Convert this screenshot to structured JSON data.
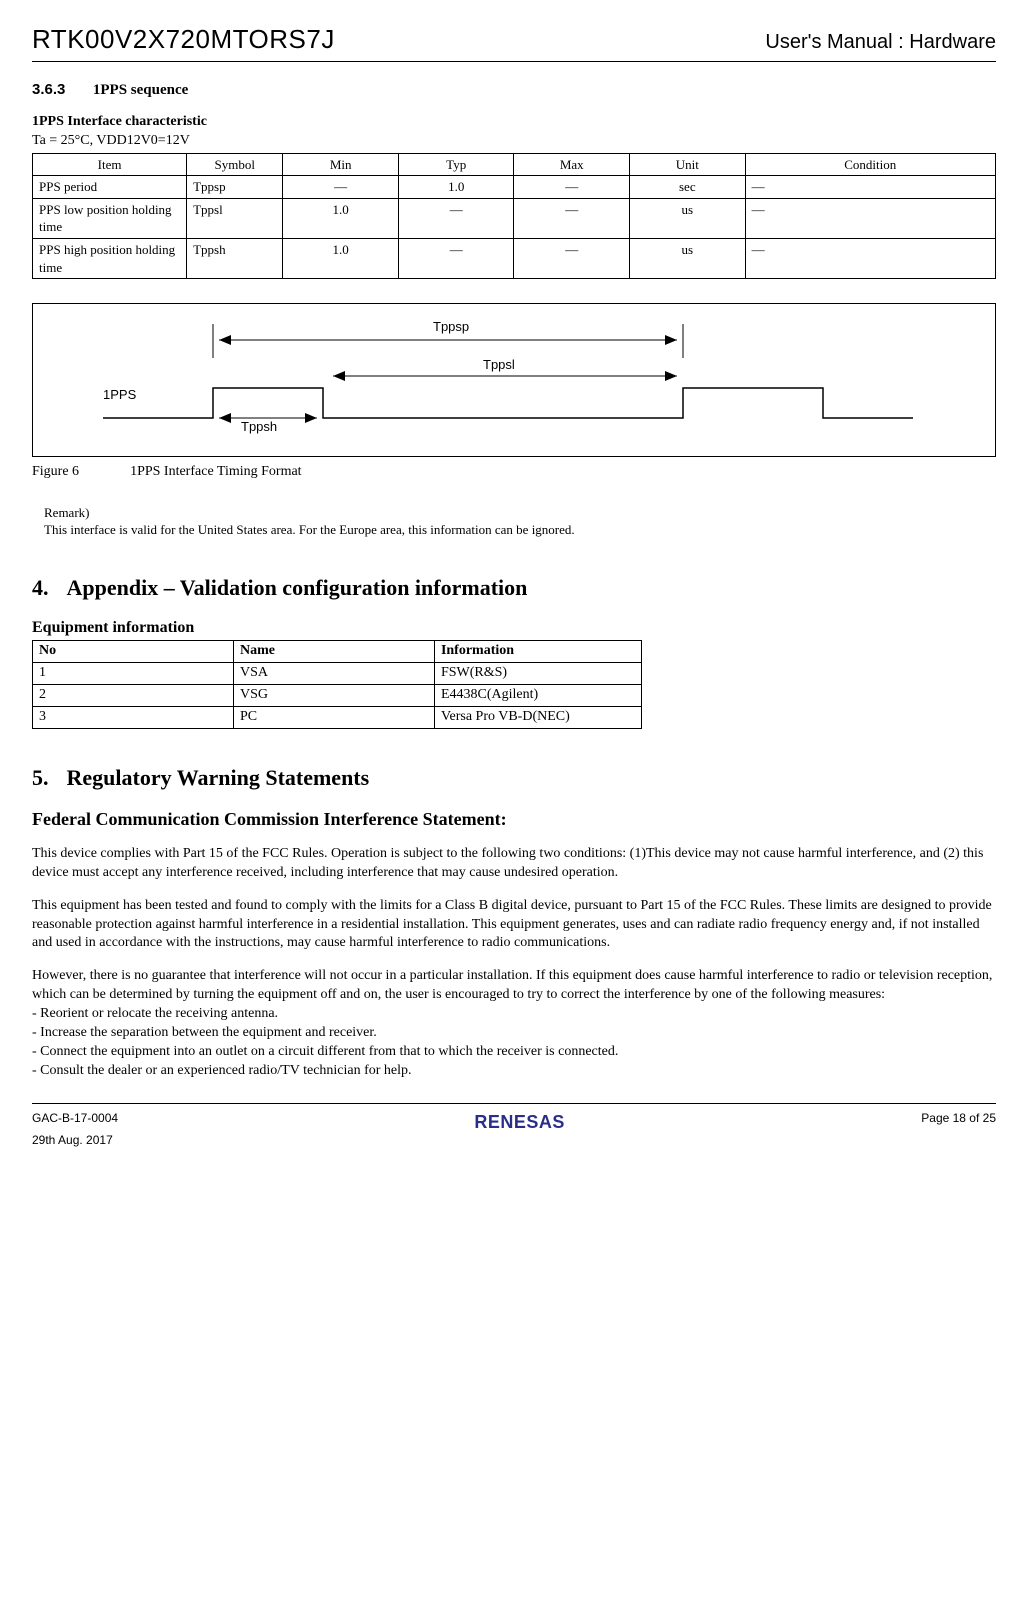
{
  "header": {
    "left": "RTK00V2X720MTORS7J",
    "right": "User's Manual : Hardware"
  },
  "section363": {
    "num": "3.6.3",
    "title": "1PPS sequence"
  },
  "pps": {
    "char_title": "1PPS Interface characteristic",
    "conditions": "Ta = 25°C, VDD12V0=12V",
    "headers": [
      "Item",
      "Symbol",
      "Min",
      "Typ",
      "Max",
      "Unit",
      "Condition"
    ],
    "rows": [
      {
        "item": "PPS period",
        "symbol": "Tppsp",
        "min": "—",
        "typ": "1.0",
        "max": "—",
        "unit": "sec",
        "cond": "—"
      },
      {
        "item": "PPS low position holding time",
        "symbol": "Tppsl",
        "min": "1.0",
        "typ": "—",
        "max": "—",
        "unit": "us",
        "cond": "—"
      },
      {
        "item": "PPS high position holding time",
        "symbol": "Tppsh",
        "min": "1.0",
        "typ": "—",
        "max": "—",
        "unit": "us",
        "cond": "—"
      }
    ]
  },
  "timing": {
    "signal": "1PPS",
    "tppsp": "Tppsp",
    "tppsl": "Tppsl",
    "tppsh": "Tppsh",
    "caption_prefix": "Figure 6",
    "caption_text": "1PPS Interface Timing Format"
  },
  "remark": {
    "label": "Remark)",
    "text": "This interface is valid for the United States area. For the Europe area, this information can be ignored."
  },
  "appendix": {
    "num": "4.",
    "title": "Appendix – Validation configuration information",
    "equip_title": "Equipment information",
    "headers": [
      "No",
      "Name",
      "Information"
    ],
    "rows": [
      {
        "no": "1",
        "name": "VSA",
        "info": "FSW(R&S)"
      },
      {
        "no": "2",
        "name": "VSG",
        "info": "E4438C(Agilent)"
      },
      {
        "no": "3",
        "name": "PC",
        "info": "Versa Pro VB-D(NEC)"
      }
    ]
  },
  "regulatory": {
    "num": "5.",
    "title": "Regulatory Warning Statements",
    "fcc_heading": "Federal Communication Commission Interference Statement:",
    "p1": "This device complies with Part 15 of the FCC Rules. Operation is subject to the following two conditions: (1)This device may not cause harmful interference, and (2) this device must accept any interference received, including interference that may cause undesired operation.",
    "p2": "This equipment has been tested and found to comply with the limits for a Class B digital device, pursuant to Part 15 of the FCC Rules. These limits are designed to provide reasonable protection against harmful interference in a residential installation. This equipment generates, uses and can radiate radio frequency energy and, if not installed and used in accordance with the instructions, may cause harmful interference to radio communications.",
    "p3": "However, there is no guarantee that interference will not occur in a particular installation. If this equipment does cause harmful interference to radio or television reception, which can be determined by turning the equipment off and on, the user is encouraged to try to correct the interference by one of the following measures:",
    "m1": "- Reorient or relocate the receiving antenna.",
    "m2": "- Increase the separation between the equipment and receiver.",
    "m3": "- Connect the equipment into an outlet on a circuit different from that to which the receiver is connected.",
    "m4": "- Consult the dealer or an experienced radio/TV technician for help."
  },
  "footer": {
    "docnum": "GAC-B-17-0004",
    "date": "29th Aug. 2017",
    "logo": "RENESAS",
    "page": "Page  18  of 25"
  }
}
